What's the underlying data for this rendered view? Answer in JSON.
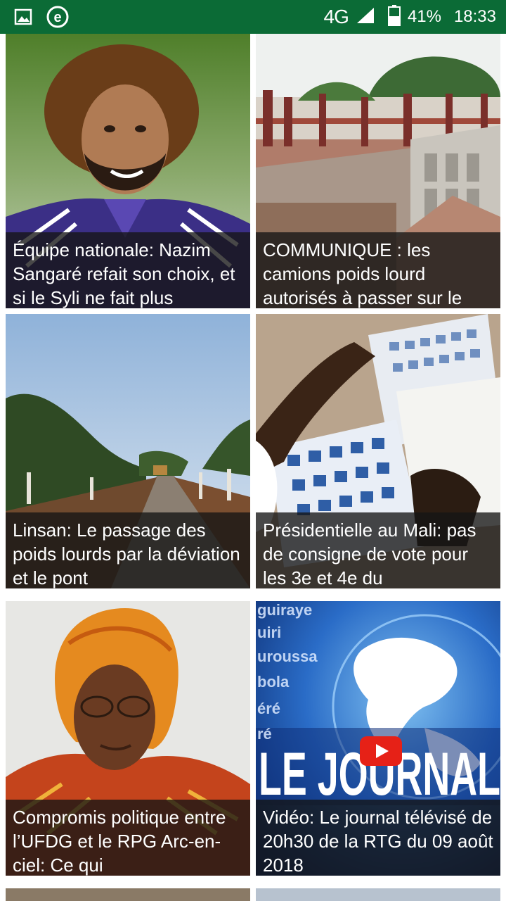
{
  "status_bar": {
    "network": "4G",
    "battery": "41%",
    "time": "18:33",
    "colors": {
      "background": "#0b6b36"
    },
    "icons": [
      "image-notification-icon",
      "e-app-notification-icon",
      "signal-icon",
      "battery-icon"
    ]
  },
  "articles": [
    {
      "title": "Équipe nationale: Nazim Sangaré refait son choix, et si le Syli ne fait plus",
      "image": "footballer-portrait"
    },
    {
      "title": "COMMUNIQUE : les camions poids lourd autorisés à passer sur le",
      "image": "bridge-crossing"
    },
    {
      "title": "Linsan: Le passage des poids lourds par la déviation et le pont",
      "image": "rural-road"
    },
    {
      "title": "Présidentielle au Mali: pas de consigne de vote pour les 3e et 4e du",
      "image": "ballot-papers"
    },
    {
      "title": "Compromis politique entre l’UFDG et le RPG Arc-en-ciel: Ce qui",
      "image": "woman-headscarf-portrait"
    },
    {
      "title": "Vidéo: Le journal télévisé de 20h30 de la RTG du 09 août 2018",
      "image": "tv-news-video",
      "video_text": "LE JOURNAL",
      "side_words": [
        "guiraye",
        "uiri",
        "uroussa",
        "bola",
        "éré",
        "ré"
      ]
    }
  ]
}
